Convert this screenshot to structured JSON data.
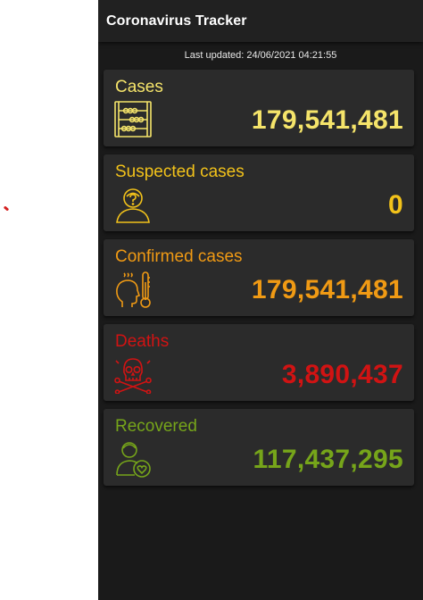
{
  "app": {
    "title": "Coronavirus Tracker"
  },
  "last_updated": "Last updated: 24/06/2021 04:21:55",
  "cards": [
    {
      "label": "Cases",
      "value": "179,541,481",
      "icon": "abacus-icon",
      "color": "#f5e46a"
    },
    {
      "label": "Suspected cases",
      "value": "0",
      "icon": "person-question-icon",
      "color": "#f2c21a"
    },
    {
      "label": "Confirmed cases",
      "value": "179,541,481",
      "icon": "fever-thermometer-icon",
      "color": "#f09a14"
    },
    {
      "label": "Deaths",
      "value": "3,890,437",
      "icon": "skull-crossbones-icon",
      "color": "#d11313"
    },
    {
      "label": "Recovered",
      "value": "117,437,295",
      "icon": "recovered-heart-icon",
      "color": "#76a51a"
    }
  ]
}
